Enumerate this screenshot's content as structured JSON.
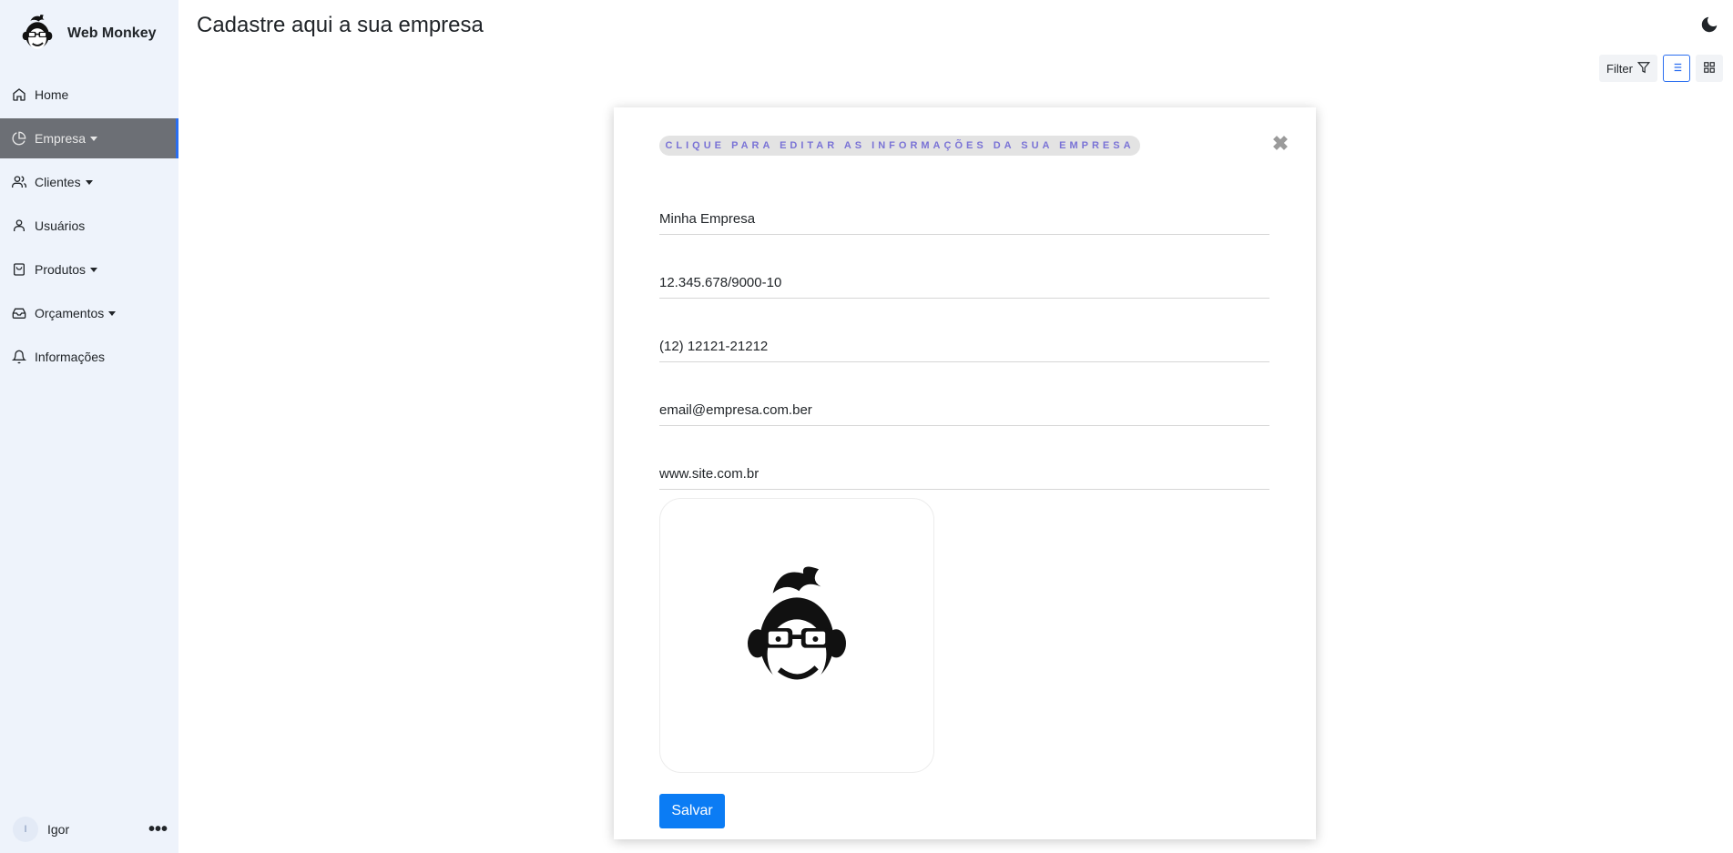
{
  "app": {
    "name": "Web Monkey",
    "logo_icon": "monkey-logo-icon"
  },
  "sidebar": {
    "items": [
      {
        "label": "Home",
        "icon": "home-icon",
        "dropdown": false
      },
      {
        "label": "Empresa",
        "icon": "pie-chart-icon",
        "dropdown": true,
        "active": true
      },
      {
        "label": "Clientes",
        "icon": "users-icon",
        "dropdown": true
      },
      {
        "label": "Usuários",
        "icon": "user-icon",
        "dropdown": false
      },
      {
        "label": "Produtos",
        "icon": "shopping-bag-icon",
        "dropdown": true
      },
      {
        "label": "Orçamentos",
        "icon": "inbox-icon",
        "dropdown": true
      },
      {
        "label": "Informações",
        "icon": "bell-icon",
        "dropdown": false
      }
    ],
    "user": {
      "initial": "I",
      "name": "Igor",
      "more": "•••"
    }
  },
  "header": {
    "title": "Cadastre aqui a sua empresa",
    "theme_icon": "moon-icon"
  },
  "toolbar": {
    "filter_label": "Filter",
    "filter_icon": "funnel-icon",
    "list_icon": "list-icon",
    "grid_icon": "grid-icon"
  },
  "card": {
    "badge": "CLIQUE PARA EDITAR AS INFORMAÇÕES DA SUA EMPRESA",
    "close": "✖",
    "fields": {
      "company_name": "Minha Empresa",
      "cnpj": "12.345.678/9000-10",
      "phone": "(12) 12121-21212",
      "email": "email@empresa.com.ber",
      "website": "www.site.com.br"
    },
    "save_label": "Salvar"
  },
  "colors": {
    "sidebar_bg": "#eef3fb",
    "active_item_bg": "#6c6f75",
    "accent": "#2a6ef0",
    "primary_button": "#0b7cf4",
    "badge_text": "#7a73d6"
  }
}
